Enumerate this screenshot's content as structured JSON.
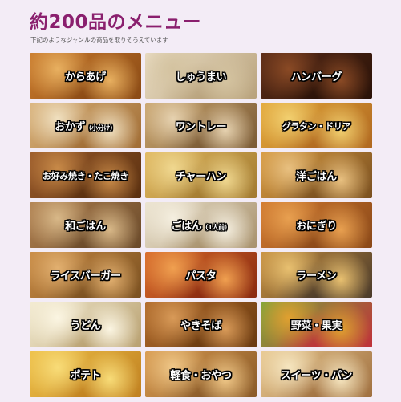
{
  "header": {
    "title": "約200品のメニュー",
    "subtitle": "下記のようなジャンルの商品を取りそろえています"
  },
  "menu": [
    {
      "label": "からあげ",
      "sub": "",
      "colors": [
        "#c97a2c",
        "#8a4a15",
        "#e8b060"
      ]
    },
    {
      "label": "しゅうまい",
      "sub": "",
      "colors": [
        "#e9dcc3",
        "#b8a27c",
        "#d4c3a0"
      ]
    },
    {
      "label": "ハンバーグ",
      "sub": "",
      "colors": [
        "#5a2c18",
        "#2a1208",
        "#8a4a25"
      ]
    },
    {
      "label": "おかず",
      "sub": "（小分け）",
      "colors": [
        "#d9b27a",
        "#a06c34",
        "#f0e0c0"
      ]
    },
    {
      "label": "ワントレー",
      "sub": "",
      "colors": [
        "#caa56e",
        "#7a5a35",
        "#e6d2b0"
      ]
    },
    {
      "label": "グラタン・ドリア",
      "sub": "",
      "colors": [
        "#e3a83a",
        "#b06820",
        "#f2d070"
      ]
    },
    {
      "label": "お好み焼き・たこ焼き",
      "sub": "",
      "colors": [
        "#9a5a2a",
        "#5a3010",
        "#c88a48"
      ]
    },
    {
      "label": "チャーハン",
      "sub": "",
      "colors": [
        "#e0b860",
        "#a27a30",
        "#f0d890"
      ]
    },
    {
      "label": "洋ごはん",
      "sub": "",
      "colors": [
        "#d89a40",
        "#7a5020",
        "#e8c080"
      ]
    },
    {
      "label": "和ごはん",
      "sub": "",
      "colors": [
        "#b08050",
        "#6a4a2a",
        "#d8b888"
      ]
    },
    {
      "label": "ごはん",
      "sub": "（1人前）",
      "colors": [
        "#ebe3d0",
        "#a8916c",
        "#f5efe0"
      ]
    },
    {
      "label": "おにぎり",
      "sub": "",
      "colors": [
        "#d27a30",
        "#8a4818",
        "#e8a050"
      ]
    },
    {
      "label": "ライスバーガー",
      "sub": "",
      "colors": [
        "#c88a44",
        "#7a5020",
        "#e2b070"
      ]
    },
    {
      "label": "パスタ",
      "sub": "",
      "colors": [
        "#d86a2a",
        "#8a2a10",
        "#f0a050"
      ]
    },
    {
      "label": "ラーメン",
      "sub": "",
      "colors": [
        "#c89040",
        "#4a3a2a",
        "#e8c070"
      ]
    },
    {
      "label": "うどん",
      "sub": "",
      "colors": [
        "#f2ead0",
        "#b8a070",
        "#fbf5e2"
      ]
    },
    {
      "label": "やきそば",
      "sub": "",
      "colors": [
        "#b06a2a",
        "#6a3a10",
        "#d89a58"
      ]
    },
    {
      "label": "野菜・果実",
      "sub": "",
      "colors": [
        "#7aa83a",
        "#c0303a",
        "#e0a030"
      ]
    },
    {
      "label": "ポテト",
      "sub": "",
      "colors": [
        "#eec048",
        "#c08020",
        "#f8dc78"
      ]
    },
    {
      "label": "軽食・おやつ",
      "sub": "",
      "colors": [
        "#d89a50",
        "#8a5a28",
        "#f0c888"
      ]
    },
    {
      "label": "スイーツ・パン",
      "sub": "",
      "colors": [
        "#e8c890",
        "#a07040",
        "#f6e6c0"
      ]
    }
  ]
}
